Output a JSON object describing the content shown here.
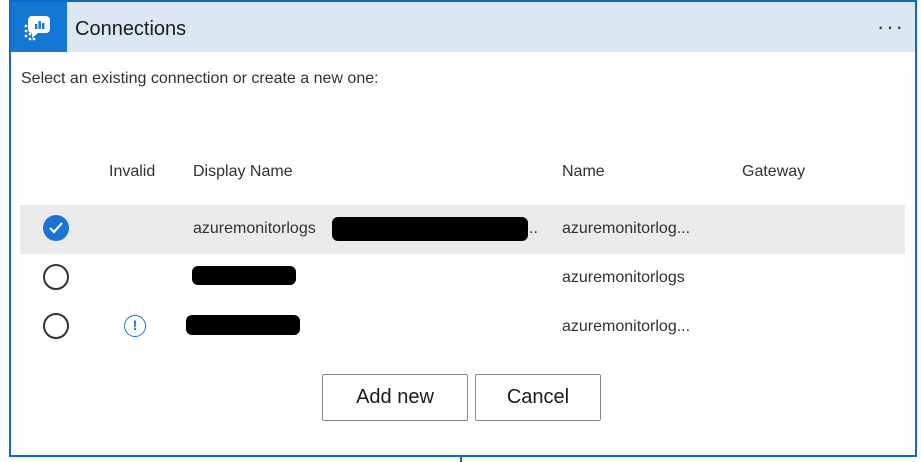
{
  "header": {
    "title": "Connections",
    "more_label": "···",
    "logo_icon": "monitor-logs-icon"
  },
  "instruction": "Select an existing connection or create a new one:",
  "columns": {
    "invalid": "Invalid",
    "display_name": "Display Name",
    "name": "Name",
    "gateway": "Gateway"
  },
  "rows": [
    {
      "selected": true,
      "invalid": false,
      "display_name": "azuremonitorlogs",
      "display_suffix": "..",
      "name": "azuremonitorlog...",
      "gateway": ""
    },
    {
      "selected": false,
      "invalid": false,
      "display_name": "",
      "name": "azuremonitorlogs",
      "gateway": ""
    },
    {
      "selected": false,
      "invalid": true,
      "display_name": "",
      "name": "azuremonitorlog...",
      "gateway": ""
    }
  ],
  "warning_glyph": "!",
  "buttons": {
    "add_new": "Add new",
    "cancel": "Cancel"
  },
  "colors": {
    "accent": "#1378d4",
    "header_bg": "#dbe8f4",
    "selected_row": "#ebebeb"
  }
}
